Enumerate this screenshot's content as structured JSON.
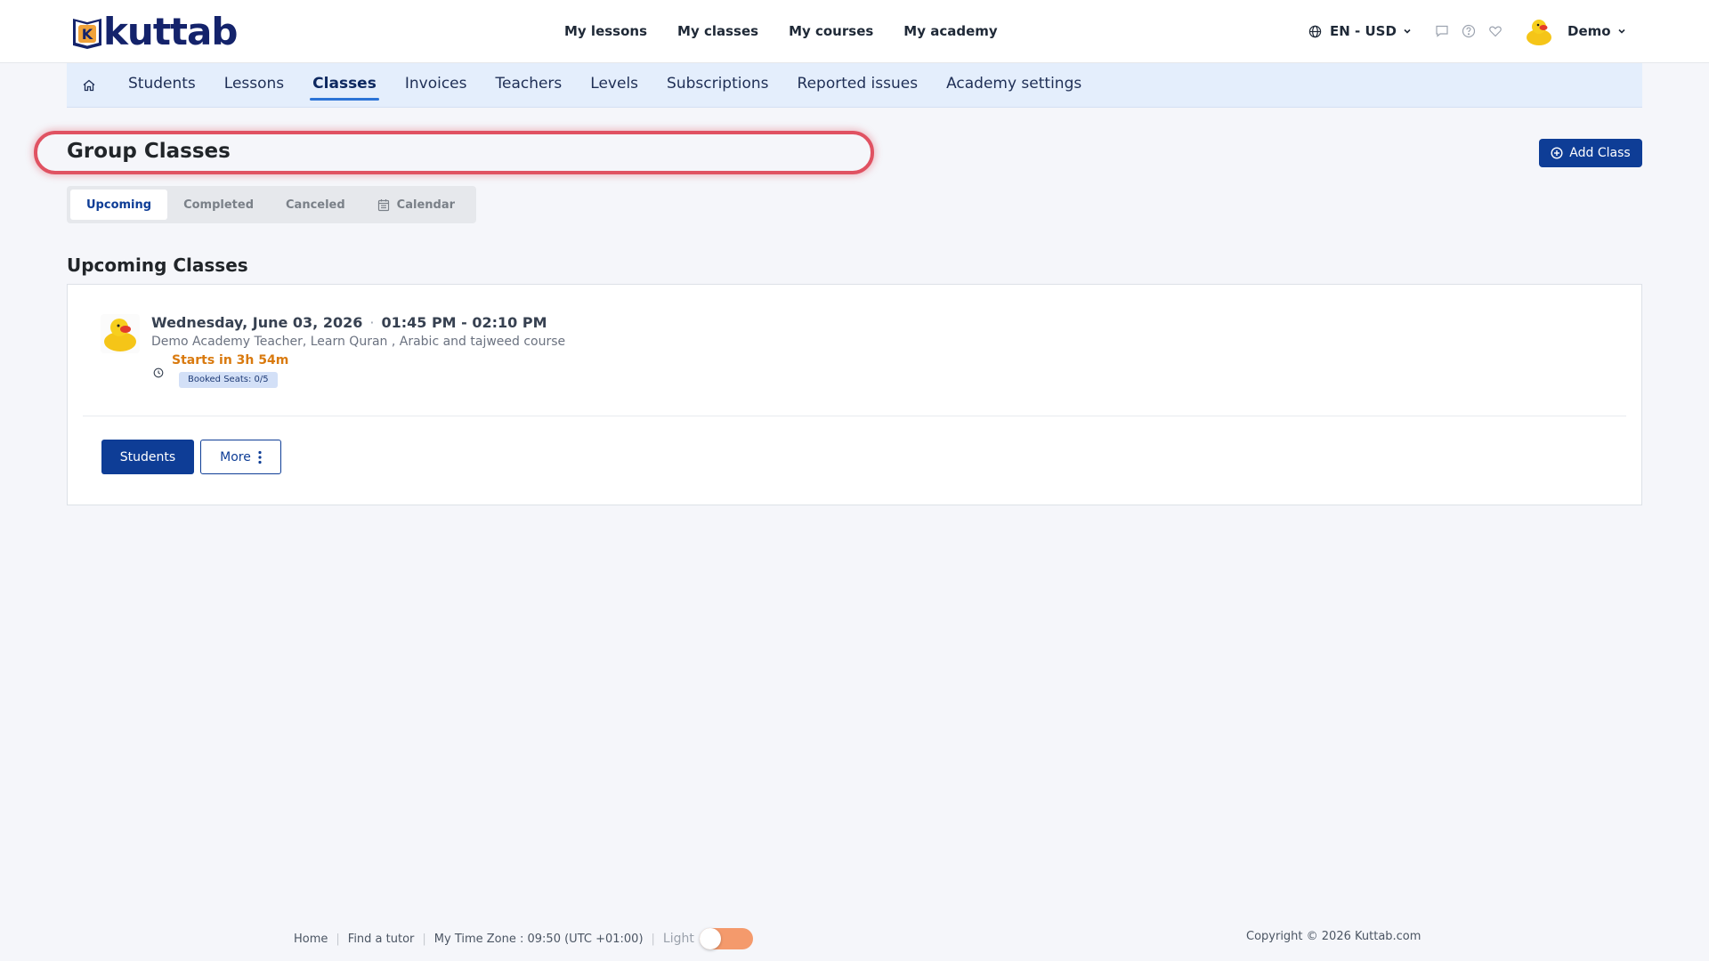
{
  "brand": {
    "logo_text": "kuttab",
    "logo_letter": "K"
  },
  "topnav": {
    "items": [
      "My lessons",
      "My classes",
      "My courses",
      "My academy"
    ]
  },
  "locale": {
    "label": "EN - USD"
  },
  "user": {
    "name": "Demo"
  },
  "subnav": {
    "items": [
      "Students",
      "Lessons",
      "Classes",
      "Invoices",
      "Teachers",
      "Levels",
      "Subscriptions",
      "Reported issues",
      "Academy settings"
    ],
    "active": "Classes"
  },
  "page": {
    "title": "Group Classes",
    "add_button": "Add Class"
  },
  "tabs": {
    "items": [
      "Upcoming",
      "Completed",
      "Canceled",
      "Calendar"
    ],
    "active": "Upcoming"
  },
  "section": {
    "title": "Upcoming Classes"
  },
  "class_item": {
    "date": "Wednesday, June 03, 2026",
    "separator": "·",
    "time": "01:45 PM - 02:10 PM",
    "description": "Demo Academy Teacher, Learn Quran , Arabic and tajweed course",
    "starts_in": "Starts in 3h 54m",
    "booked_seats": "Booked Seats: 0/5",
    "students_button": "Students",
    "more_button": "More"
  },
  "footer": {
    "links": [
      "Home",
      "Find a tutor"
    ],
    "timezone": "My Time Zone : 09:50 (UTC +01:00)",
    "theme_label": "Light",
    "copyright": "Copyright © 2026 Kuttab.com"
  },
  "colors": {
    "primary": "#0e3d96",
    "subnav_bg": "#e4eefc",
    "highlight_border": "#e05262",
    "starts_text": "#d97a0f",
    "toggle": "#f49a6c"
  }
}
